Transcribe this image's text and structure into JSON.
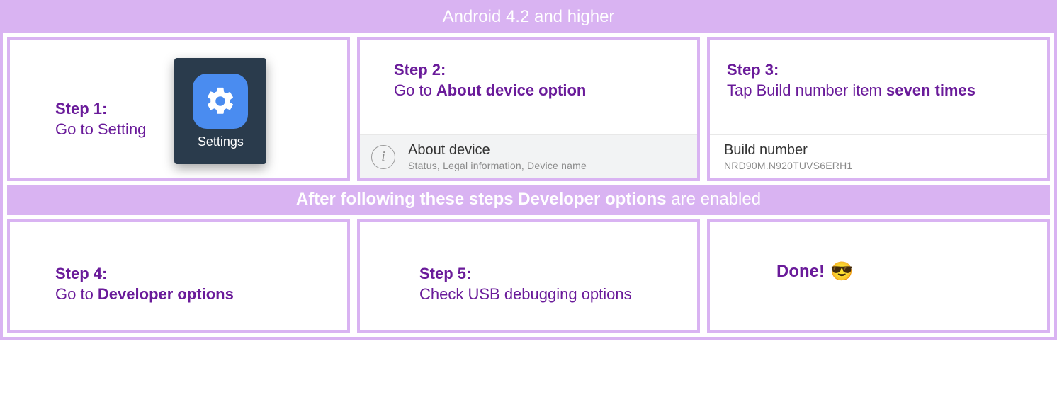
{
  "header": "Android 4.2 and higher",
  "steps": {
    "s1": {
      "title": "Step 1:",
      "body": "Go to Setting"
    },
    "s2": {
      "title": "Step 2:",
      "body_prefix": "Go to ",
      "body_bold": "About device option"
    },
    "s3": {
      "title": "Step 3:",
      "body_prefix": "Tap Build number item ",
      "body_bold": "seven times"
    },
    "s4": {
      "title": "Step 4:",
      "body_prefix": "Go to ",
      "body_bold": "Developer options"
    },
    "s5": {
      "title": "Step 5:",
      "body": "Check USB debugging options"
    }
  },
  "settings_app_label": "Settings",
  "about_device": {
    "title": "About device",
    "subtitle": "Status, Legal information, Device name"
  },
  "build_number": {
    "title": "Build number",
    "value": "NRD90M.N920TUVS6ERH1"
  },
  "interbar_bold": "After following these steps Developer options",
  "interbar_rest": " are enabled",
  "done_label": "Done!",
  "done_emoji": "😎",
  "info_glyph": "i"
}
